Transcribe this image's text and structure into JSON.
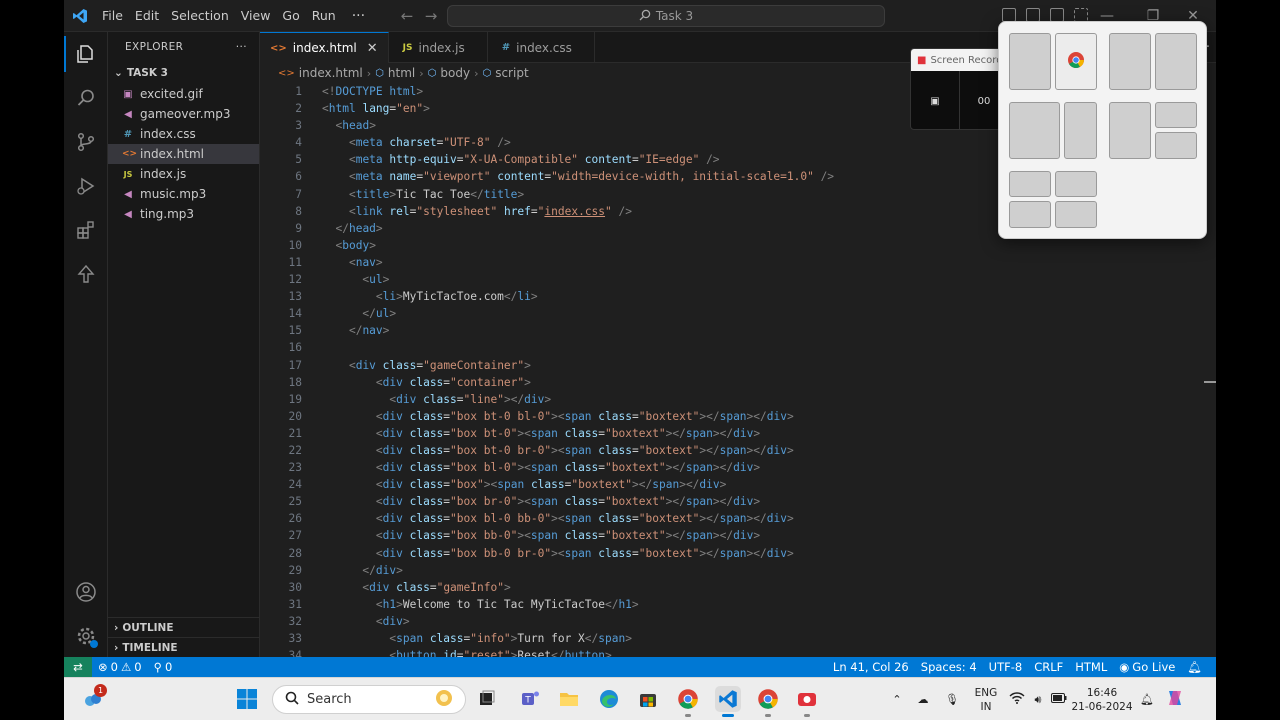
{
  "window": {
    "menu": [
      "File",
      "Edit",
      "Selection",
      "View",
      "Go",
      "Run"
    ],
    "menu_more": "···",
    "command_center": "Task 3",
    "minimize": "—",
    "restore": "❐",
    "close": "✕"
  },
  "sidebar": {
    "title": "EXPLORER",
    "more": "···",
    "folder": "TASK 3",
    "files": [
      {
        "name": "excited.gif",
        "icon": "image-icon",
        "color": "#c586c0"
      },
      {
        "name": "gameover.mp3",
        "icon": "audio-icon",
        "color": "#c586c0"
      },
      {
        "name": "index.css",
        "icon": "css-icon",
        "color": "#519aba"
      },
      {
        "name": "index.html",
        "icon": "html-icon",
        "color": "#e37933"
      },
      {
        "name": "index.js",
        "icon": "js-icon",
        "color": "#cbcb41"
      },
      {
        "name": "music.mp3",
        "icon": "audio-icon",
        "color": "#c586c0"
      },
      {
        "name": "ting.mp3",
        "icon": "audio-icon",
        "color": "#c586c0"
      }
    ],
    "outline": "OUTLINE",
    "timeline": "TIMELINE"
  },
  "tabs": [
    {
      "label": "index.html",
      "prefix": "<>",
      "active": true
    },
    {
      "label": "index.js",
      "prefix": "JS",
      "active": false
    },
    {
      "label": "index.css",
      "prefix": "#",
      "active": false
    }
  ],
  "tab_close": "✕",
  "breadcrumb": [
    "index.html",
    "html",
    "body",
    "script"
  ],
  "code_lines": [
    "<!DOCTYPE html>",
    "<html lang=\"en\">",
    "  <head>",
    "    <meta charset=\"UTF-8\" />",
    "    <meta http-equiv=\"X-UA-Compatible\" content=\"IE=edge\" />",
    "    <meta name=\"viewport\" content=\"width=device-width, initial-scale=1.0\" />",
    "    <title>Tic Tac Toe</title>",
    "    <link rel=\"stylesheet\" href=\"index.css\" />",
    "  </head>",
    "  <body>",
    "    <nav>",
    "      <ul>",
    "        <li>MyTicTacToe.com</li>",
    "      </ul>",
    "    </nav>",
    "",
    "    <div class=\"gameContainer\">",
    "        <div class=\"container\">",
    "          <div class=\"line\"></div>",
    "        <div class=\"box bt-0 bl-0\"><span class=\"boxtext\"></span></div>",
    "        <div class=\"box bt-0\"><span class=\"boxtext\"></span></div>",
    "        <div class=\"box bt-0 br-0\"><span class=\"boxtext\"></span></div>",
    "        <div class=\"box bl-0\"><span class=\"boxtext\"></span></div>",
    "        <div class=\"box\"><span class=\"boxtext\"></span></div>",
    "        <div class=\"box br-0\"><span class=\"boxtext\"></span></div>",
    "        <div class=\"box bl-0 bb-0\"><span class=\"boxtext\"></span></div>",
    "        <div class=\"box bb-0\"><span class=\"boxtext\"></span></div>",
    "        <div class=\"box bb-0 br-0\"><span class=\"boxtext\"></span></div>",
    "      </div>",
    "      <div class=\"gameInfo\">",
    "        <h1>Welcome to Tic Tac MyTicTacToe</h1>",
    "        <div>",
    "          <span class=\"info\">Turn for X</span>",
    "          <button id=\"reset\">Reset</button>"
  ],
  "recorder": {
    "title": "Screen Recorder",
    "time": "00"
  },
  "statusbar": {
    "errors": "0",
    "warnings": "0",
    "ports": "0",
    "position": "Ln 41, Col 26",
    "spaces": "Spaces: 4",
    "encoding": "UTF-8",
    "eol": "CRLF",
    "language": "HTML",
    "golive": "Go Live"
  },
  "taskbar": {
    "search_placeholder": "Search",
    "widget_badge": "1",
    "lang_line1": "ENG",
    "lang_line2": "IN",
    "time": "16:46",
    "date": "21-06-2024"
  },
  "colors": {
    "accent": "#0078d4",
    "tag": "#569cd6",
    "attr": "#9cdcfe",
    "string": "#ce9178"
  }
}
